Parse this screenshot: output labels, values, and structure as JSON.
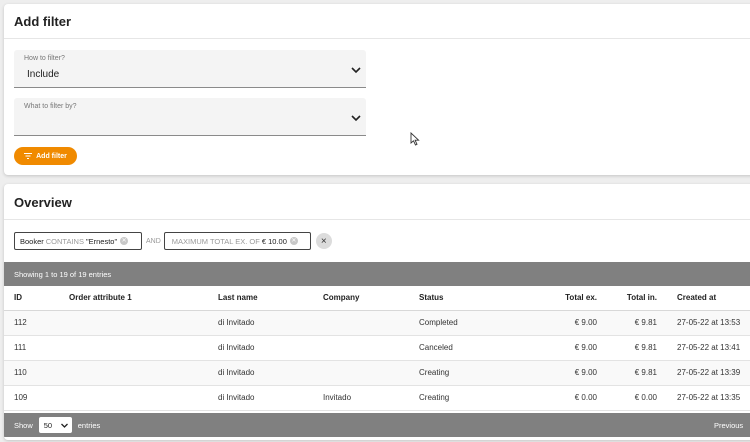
{
  "filter_panel": {
    "title": "Add filter",
    "how": {
      "label": "How to filter?",
      "value": "Include"
    },
    "what": {
      "label": "What to filter by?",
      "value": ""
    },
    "add_button": "Add filter"
  },
  "overview": {
    "title": "Overview",
    "chips": [
      {
        "field": "Booker",
        "operator": "CONTAINS",
        "value": "\"Ernesto\""
      },
      {
        "field": "",
        "operator": "MAXIMUM TOTAL EX. OF",
        "value": "€ 10.00"
      }
    ],
    "and_label": "AND",
    "clear_symbol": "×",
    "showing": "Showing 1 to 19 of 19 entries",
    "columns": [
      "ID",
      "Order attribute 1",
      "Last name",
      "Company",
      "Status",
      "Total ex.",
      "Total in.",
      "Created at"
    ],
    "rows": [
      {
        "id": "112",
        "attr": "",
        "last_name": "di Invitado",
        "company": "",
        "status": "Completed",
        "total_ex": "€ 9.00",
        "total_in": "€ 9.81",
        "created": "27-05-22 at 13:53"
      },
      {
        "id": "111",
        "attr": "",
        "last_name": "di Invitado",
        "company": "",
        "status": "Canceled",
        "total_ex": "€ 9.00",
        "total_in": "€ 9.81",
        "created": "27-05-22 at 13:41"
      },
      {
        "id": "110",
        "attr": "",
        "last_name": "di Invitado",
        "company": "",
        "status": "Creating",
        "total_ex": "€ 9.00",
        "total_in": "€ 9.81",
        "created": "27-05-22 at 13:39"
      },
      {
        "id": "109",
        "attr": "",
        "last_name": "di Invitado",
        "company": "Invitado",
        "status": "Creating",
        "total_ex": "€ 0.00",
        "total_in": "€ 0.00",
        "created": "27-05-22 at 13:35"
      }
    ],
    "footer": {
      "show_label": "Show",
      "page_size": "50",
      "entries_label": "entries",
      "previous": "Previous"
    }
  },
  "colors": {
    "accent": "#f08a00",
    "bar": "#808080"
  }
}
